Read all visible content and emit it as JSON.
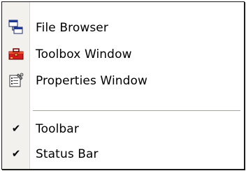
{
  "menu": {
    "items": [
      {
        "label": "File Browser",
        "icon": "file-browser-icon"
      },
      {
        "label": "Toolbox Window",
        "icon": "toolbox-icon"
      },
      {
        "label": "Properties Window",
        "icon": "properties-icon"
      }
    ],
    "toggles": [
      {
        "label": "Toolbar",
        "checked": true
      },
      {
        "label": "Status Bar",
        "checked": true
      }
    ]
  },
  "colors": {
    "strip": "#f2f1ed",
    "border": "#1a1a1a",
    "separator": "#a7a59f"
  }
}
